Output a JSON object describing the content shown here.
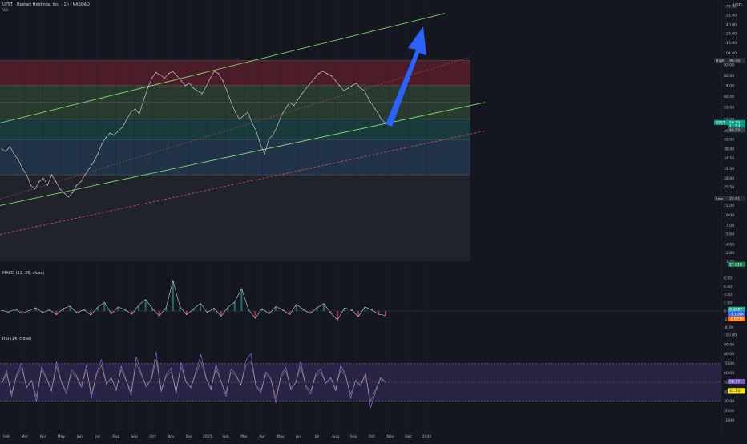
{
  "header": {
    "symbol_line": "UPST · Upstart Holdings, Inc. · 1h · NASDAQ",
    "vol_label": "Vol",
    "currency": "USD"
  },
  "colors": {
    "background": "#141720",
    "red_zone": "#7a2331",
    "green_zone": "#3a5a3a",
    "teal_zone": "#1f5a55",
    "blue_zone": "#2a4a6a",
    "grey_zone": "#2a2d35",
    "channel": "#7fd46e",
    "dashed_trend": "#e04a64",
    "arrow": "#2962ff",
    "macd_line": "#e0e0e0",
    "rsi_line_a": "#9b7bff",
    "rsi_line_b": "#e9d46a"
  },
  "chart_data": [
    {
      "type": "line",
      "panel": "price",
      "y_scale": "log",
      "yaxis_ticks": [
        "170.00",
        "155.00",
        "140.00",
        "128.00",
        "116.00",
        "104.00",
        "92.00",
        "82.00",
        "74.00",
        "66.00",
        "59.00",
        "52.00",
        "46.00",
        "42.00",
        "38.00",
        "34.50",
        "31.00",
        "28.00",
        "25.50",
        "23.00",
        "21.00",
        "19.00",
        "17.00",
        "15.60",
        "14.00",
        "12.80",
        "11.70"
      ],
      "xaxis_ticks": [
        "Feb",
        "Mar",
        "Apr",
        "May",
        "Jun",
        "Jul",
        "Aug",
        "Sep",
        "Oct",
        "Nov",
        "Dec",
        "2025",
        "Feb",
        "Mar",
        "Apr",
        "May",
        "Jun",
        "Jul",
        "Aug",
        "Sep",
        "Oct",
        "Nov",
        "Dec",
        "2026"
      ],
      "labels": {
        "high": "High",
        "high_value": "96.40",
        "low": "Low",
        "low_value": "22.61",
        "symbol_tag": "UPST",
        "last_price": "50.19",
        "vol_value": "27.61K",
        "countdown": "11:53",
        "prev_close": "49.55"
      },
      "fib_zones": [
        {
          "from": 96.4,
          "to": 74.0,
          "color": "red"
        },
        {
          "from": 74.0,
          "to": 62.0,
          "color": "green"
        },
        {
          "from": 62.0,
          "to": 52.0,
          "color": "green"
        },
        {
          "from": 52.0,
          "to": 42.0,
          "color": "teal"
        },
        {
          "from": 42.0,
          "to": 29.0,
          "color": "blue"
        },
        {
          "from": 29.0,
          "to": 11.7,
          "color": "grey"
        }
      ],
      "series": [
        {
          "values": [
            38,
            37,
            39,
            36,
            34,
            31,
            29,
            26,
            25,
            27,
            28,
            26,
            29,
            27,
            25,
            24,
            23,
            24,
            26,
            27,
            29,
            31,
            33,
            36,
            40,
            43,
            45,
            44,
            46,
            48,
            52,
            56,
            58,
            55,
            63,
            72,
            80,
            85,
            83,
            80,
            84,
            86,
            82,
            78,
            74,
            76,
            72,
            70,
            68,
            73,
            80,
            86,
            84,
            78,
            70,
            62,
            56,
            52,
            54,
            56,
            50,
            46,
            40,
            36,
            42,
            44,
            48,
            54,
            58,
            62,
            60,
            64,
            68,
            72,
            76,
            80,
            84,
            86,
            84,
            82,
            78,
            74,
            70,
            72,
            74,
            76,
            72,
            70,
            64,
            60,
            56,
            52,
            50
          ]
        }
      ]
    },
    {
      "type": "line",
      "panel": "macd",
      "title": "MACD (12, 26, close)",
      "yaxis_ticks": [
        "8.00",
        "6.00",
        "4.00",
        "2.00",
        "0.00",
        "-2.00",
        "-4.00"
      ],
      "labels": {
        "histogram": "0.4887",
        "macd": "-1.1099",
        "signal": "-0.6210"
      },
      "series": [
        {
          "values": [
            0.2,
            -0.3,
            0.5,
            -0.6,
            0.1,
            0.8,
            -0.4,
            0.3,
            -0.9,
            0.6,
            1.2,
            -0.5,
            0.4,
            -1.0,
            0.9,
            2.1,
            -0.7,
            1.0,
            0.3,
            -0.8,
            1.4,
            2.8,
            0.6,
            -1.2,
            0.8,
            7.5,
            1.1,
            -0.9,
            0.5,
            1.9,
            -0.4,
            0.7,
            -1.3,
            0.9,
            2.2,
            5.5,
            0.4,
            -1.8,
            0.6,
            -0.7,
            1.1,
            0.3,
            -0.9,
            1.6,
            0.4,
            -0.6,
            0.8,
            1.8,
            -0.5,
            -2.2,
            0.7,
            0.4,
            -1.4,
            1.0,
            0.3,
            -0.8,
            -1.1
          ]
        }
      ]
    },
    {
      "type": "line",
      "panel": "rsi",
      "title": "RSI (14, close)",
      "yaxis_ticks": [
        "100.00",
        "90.00",
        "80.00",
        "70.00",
        "60.00",
        "50.00",
        "40.00",
        "30.00",
        "20.00",
        "10.00"
      ],
      "labels": {
        "rsi": "50.77",
        "rsi_ma": "41.14"
      },
      "series": [
        {
          "values": [
            48,
            62,
            35,
            58,
            70,
            44,
            52,
            30,
            66,
            55,
            40,
            72,
            50,
            38,
            63,
            57,
            45,
            68,
            33,
            59,
            74,
            48,
            55,
            41,
            67,
            52,
            36,
            77,
            60,
            45,
            53,
            82,
            40,
            58,
            65,
            38,
            71,
            50,
            44,
            62,
            79,
            55,
            42,
            69,
            51,
            35,
            64,
            58,
            47,
            73,
            80,
            46,
            39,
            61,
            54,
            28,
            57,
            66,
            42,
            50,
            72,
            45,
            38,
            59,
            64,
            49,
            55,
            41,
            68,
            58,
            33,
            52,
            46,
            60,
            23,
            40,
            55,
            50
          ]
        }
      ]
    }
  ]
}
